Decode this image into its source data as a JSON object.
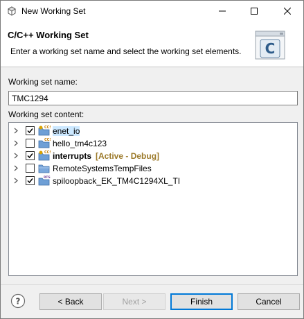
{
  "window": {
    "title": "New Working Set",
    "controls": {
      "minimize_icon": "minimize-icon",
      "maximize_icon": "maximize-icon",
      "close_icon": "close-icon"
    }
  },
  "banner": {
    "title": "C/C++ Working Set",
    "description": "Enter a working set name and select the working set elements.",
    "icon": "c-project-icon"
  },
  "form": {
    "name_label": "Working set name:",
    "name_value": "TMC1294",
    "content_label": "Working set content:"
  },
  "projects": [
    {
      "name": "enet_io",
      "checked": true,
      "bold": false,
      "suffix": "",
      "icon": "ccs-project-icon",
      "selected": true
    },
    {
      "name": "hello_tm4c123",
      "checked": false,
      "bold": false,
      "suffix": "",
      "icon": "ccs-project-icon",
      "selected": false
    },
    {
      "name": "interrupts",
      "checked": true,
      "bold": true,
      "suffix": "[Active - Debug]",
      "icon": "ccs-project-icon",
      "selected": false
    },
    {
      "name": "RemoteSystemsTempFiles",
      "checked": false,
      "bold": false,
      "suffix": "",
      "icon": "folder-icon",
      "selected": false
    },
    {
      "name": "spiloopback_EK_TM4C1294XL_TI",
      "checked": true,
      "bold": false,
      "suffix": "",
      "icon": "rtsc-project-icon",
      "selected": false
    }
  ],
  "buttons": {
    "help_icon": "help-icon",
    "back": "< Back",
    "next": "Next >",
    "finish": "Finish",
    "cancel": "Cancel"
  },
  "colors": {
    "accent": "#0078d7",
    "active_suffix": "#9c7a2a",
    "selection": "#cce8ff"
  }
}
